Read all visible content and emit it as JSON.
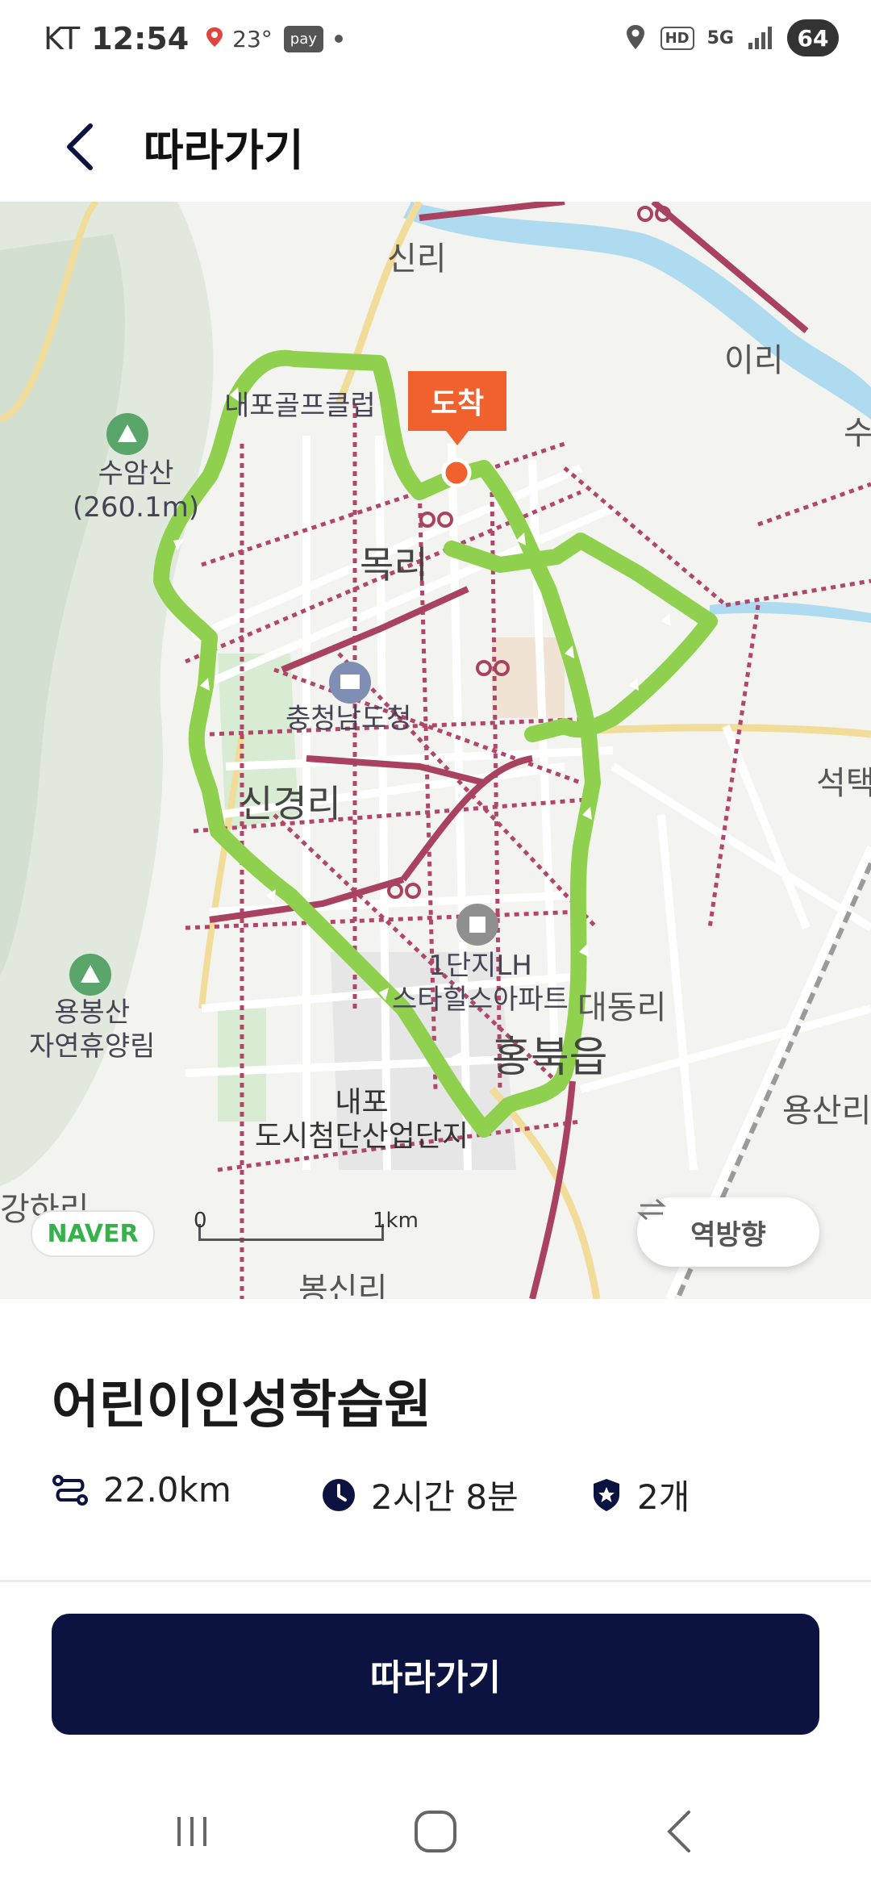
{
  "status_bar": {
    "carrier": "KT",
    "time": "12:54",
    "temperature": "23°",
    "pay_label": "pay",
    "hd_label": "HD",
    "network_label": "5G",
    "battery": "64"
  },
  "header": {
    "title": "따라가기"
  },
  "map": {
    "destination_badge": "도착",
    "place_labels": {
      "sinri": "신리",
      "iri": "이리",
      "mokri": "목리",
      "singyeongri": "신경리",
      "daedongri": "대동리",
      "hongbukeup": "홍북읍",
      "yongsanri": "용산리",
      "seoktaek": "석택",
      "su": "수",
      "gangha": "강하리",
      "bongsin": "봉신리"
    },
    "poi_labels": {
      "golf": "내포골프클럽",
      "suamsan": "수암산\n(260.1m)",
      "chungnam": "충청남도청",
      "lh_apt": "1단지LH\n스타힐스아파트",
      "yongbong": "용봉산\n자연휴양림",
      "naepo": "내포\n도시첨단산업단지"
    },
    "brand": "NAVER",
    "scale_start": "0",
    "scale_end": "1km",
    "reverse_button": "역방향"
  },
  "course": {
    "name": "어린이인성학습원",
    "distance": "22.0km",
    "duration": "2시간 8분",
    "badges": "2개"
  },
  "action": {
    "follow_label": "따라가기"
  },
  "colors": {
    "route": "#8fd14f",
    "bike_road": "#a8425f",
    "destination": "#f0612d",
    "primary_button": "#0c1340",
    "river": "#aedbef"
  }
}
